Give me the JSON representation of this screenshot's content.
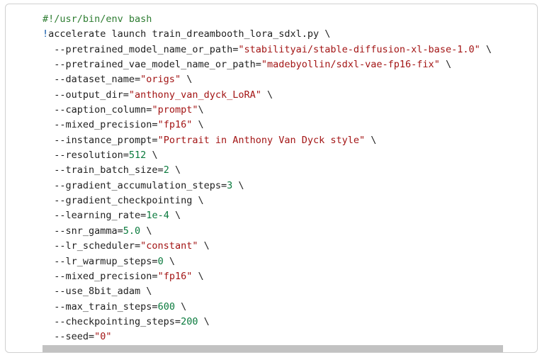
{
  "code_lines": [
    [
      {
        "t": "#!/usr/bin/env bash",
        "k": "comment"
      }
    ],
    [
      {
        "t": "!",
        "k": "bang"
      },
      {
        "t": "accelerate launch train_dreambooth_lora_sdxl.py \\",
        "k": "plain"
      }
    ],
    [
      {
        "t": "  --pretrained_model_name_or_path=",
        "k": "plain"
      },
      {
        "t": "\"stabilityai/stable-diffusion-xl-base-1.0\"",
        "k": "str"
      },
      {
        "t": " \\",
        "k": "plain"
      }
    ],
    [
      {
        "t": "  --pretrained_vae_model_name_or_path=",
        "k": "plain"
      },
      {
        "t": "\"madebyollin/sdxl-vae-fp16-fix\"",
        "k": "str"
      },
      {
        "t": " \\",
        "k": "plain"
      }
    ],
    [
      {
        "t": "  --dataset_name=",
        "k": "plain"
      },
      {
        "t": "\"origs\"",
        "k": "str"
      },
      {
        "t": " \\",
        "k": "plain"
      }
    ],
    [
      {
        "t": "  --output_dir=",
        "k": "plain"
      },
      {
        "t": "\"anthony_van_dyck_LoRA\"",
        "k": "str"
      },
      {
        "t": " \\",
        "k": "plain"
      }
    ],
    [
      {
        "t": "  --caption_column=",
        "k": "plain"
      },
      {
        "t": "\"prompt\"",
        "k": "str"
      },
      {
        "t": "\\",
        "k": "plain"
      }
    ],
    [
      {
        "t": "  --mixed_precision=",
        "k": "plain"
      },
      {
        "t": "\"fp16\"",
        "k": "str"
      },
      {
        "t": " \\",
        "k": "plain"
      }
    ],
    [
      {
        "t": "  --instance_prompt=",
        "k": "plain"
      },
      {
        "t": "\"Portrait in Anthony Van Dyck style\"",
        "k": "str"
      },
      {
        "t": " \\",
        "k": "plain"
      }
    ],
    [
      {
        "t": "  --resolution=",
        "k": "plain"
      },
      {
        "t": "512",
        "k": "num"
      },
      {
        "t": " \\",
        "k": "plain"
      }
    ],
    [
      {
        "t": "  --train_batch_size=",
        "k": "plain"
      },
      {
        "t": "2",
        "k": "num"
      },
      {
        "t": " \\",
        "k": "plain"
      }
    ],
    [
      {
        "t": "  --gradient_accumulation_steps=",
        "k": "plain"
      },
      {
        "t": "3",
        "k": "num"
      },
      {
        "t": " \\",
        "k": "plain"
      }
    ],
    [
      {
        "t": "  --gradient_checkpointing \\",
        "k": "plain"
      }
    ],
    [
      {
        "t": "  --learning_rate=",
        "k": "plain"
      },
      {
        "t": "1e-4",
        "k": "num"
      },
      {
        "t": " \\",
        "k": "plain"
      }
    ],
    [
      {
        "t": "  --snr_gamma=",
        "k": "plain"
      },
      {
        "t": "5.0",
        "k": "num"
      },
      {
        "t": " \\",
        "k": "plain"
      }
    ],
    [
      {
        "t": "  --lr_scheduler=",
        "k": "plain"
      },
      {
        "t": "\"constant\"",
        "k": "str"
      },
      {
        "t": " \\",
        "k": "plain"
      }
    ],
    [
      {
        "t": "  --lr_warmup_steps=",
        "k": "plain"
      },
      {
        "t": "0",
        "k": "num"
      },
      {
        "t": " \\",
        "k": "plain"
      }
    ],
    [
      {
        "t": "  --mixed_precision=",
        "k": "plain"
      },
      {
        "t": "\"fp16\"",
        "k": "str"
      },
      {
        "t": " \\",
        "k": "plain"
      }
    ],
    [
      {
        "t": "  --use_8bit_adam \\",
        "k": "plain"
      }
    ],
    [
      {
        "t": "  --max_train_steps=",
        "k": "plain"
      },
      {
        "t": "600",
        "k": "num"
      },
      {
        "t": " \\",
        "k": "plain"
      }
    ],
    [
      {
        "t": "  --checkpointing_steps=",
        "k": "plain"
      },
      {
        "t": "200",
        "k": "num"
      },
      {
        "t": " \\",
        "k": "plain"
      }
    ],
    [
      {
        "t": "  --seed=",
        "k": "plain"
      },
      {
        "t": "\"0\"",
        "k": "str"
      }
    ]
  ],
  "colors": {
    "comment": "#2e7d32",
    "bang": "#0b56a8",
    "string": "#a31515",
    "number": "#0a7a3d",
    "text": "#1f1f1f",
    "scrollbar": "#c2c2c2",
    "border": "#d0d0d0"
  }
}
